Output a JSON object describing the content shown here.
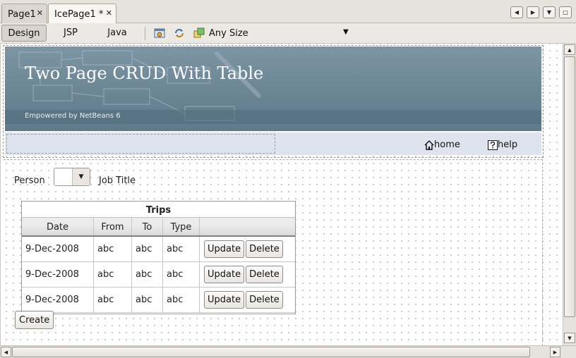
{
  "tabs": [
    {
      "label": "Page1",
      "close": "✕"
    },
    {
      "label": "IcePage1 *",
      "close": "✕"
    }
  ],
  "window_nav": [
    "◀",
    "▶",
    "▼",
    "□"
  ],
  "toolbar": {
    "design": "Design",
    "jsp": "JSP",
    "java": "Java",
    "size_label": "Any Size",
    "size_arrow": "▼",
    "icons": [
      "preview-in-browser-icon",
      "refresh-icon",
      "target-size-icon"
    ]
  },
  "banner": {
    "title": "Two Page CRUD With Table",
    "subtitle": "Empowered by NetBeans 6"
  },
  "nav": {
    "home": "home",
    "help": "help"
  },
  "form": {
    "person_label": "Person",
    "job_title_label": "Job Title",
    "select_arrow": "▼"
  },
  "table": {
    "caption": "Trips",
    "columns": [
      "Date",
      "From",
      "To",
      "Type",
      ""
    ],
    "rows": [
      {
        "date": "9-Dec-2008",
        "from": "abc",
        "to": "abc",
        "type": "abc",
        "update": "Update",
        "delete": "Delete"
      },
      {
        "date": "9-Dec-2008",
        "from": "abc",
        "to": "abc",
        "type": "abc",
        "update": "Update",
        "delete": "Delete"
      },
      {
        "date": "9-Dec-2008",
        "from": "abc",
        "to": "abc",
        "type": "abc",
        "update": "Update",
        "delete": "Delete"
      }
    ]
  },
  "create_button": "Create",
  "scroll_arrows": {
    "up": "▲",
    "down": "▼",
    "left": "◀",
    "right": "▶"
  }
}
